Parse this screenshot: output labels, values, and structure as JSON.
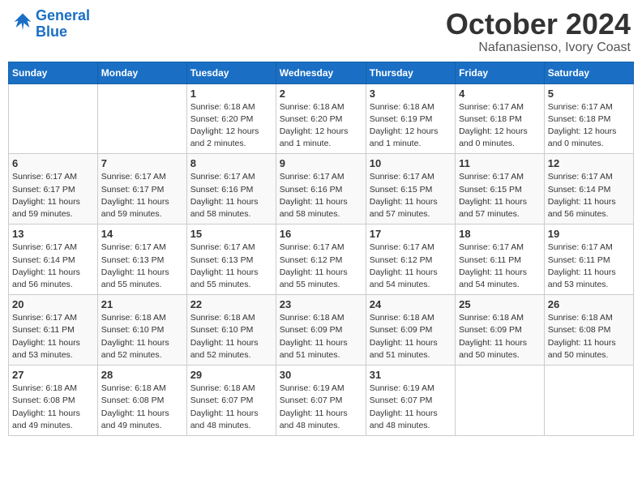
{
  "header": {
    "logo_line1": "General",
    "logo_line2": "Blue",
    "month": "October 2024",
    "location": "Nafanasienso, Ivory Coast"
  },
  "weekdays": [
    "Sunday",
    "Monday",
    "Tuesday",
    "Wednesday",
    "Thursday",
    "Friday",
    "Saturday"
  ],
  "weeks": [
    [
      {
        "day": "",
        "detail": ""
      },
      {
        "day": "",
        "detail": ""
      },
      {
        "day": "1",
        "detail": "Sunrise: 6:18 AM\nSunset: 6:20 PM\nDaylight: 12 hours\nand 2 minutes."
      },
      {
        "day": "2",
        "detail": "Sunrise: 6:18 AM\nSunset: 6:20 PM\nDaylight: 12 hours\nand 1 minute."
      },
      {
        "day": "3",
        "detail": "Sunrise: 6:18 AM\nSunset: 6:19 PM\nDaylight: 12 hours\nand 1 minute."
      },
      {
        "day": "4",
        "detail": "Sunrise: 6:17 AM\nSunset: 6:18 PM\nDaylight: 12 hours\nand 0 minutes."
      },
      {
        "day": "5",
        "detail": "Sunrise: 6:17 AM\nSunset: 6:18 PM\nDaylight: 12 hours\nand 0 minutes."
      }
    ],
    [
      {
        "day": "6",
        "detail": "Sunrise: 6:17 AM\nSunset: 6:17 PM\nDaylight: 11 hours\nand 59 minutes."
      },
      {
        "day": "7",
        "detail": "Sunrise: 6:17 AM\nSunset: 6:17 PM\nDaylight: 11 hours\nand 59 minutes."
      },
      {
        "day": "8",
        "detail": "Sunrise: 6:17 AM\nSunset: 6:16 PM\nDaylight: 11 hours\nand 58 minutes."
      },
      {
        "day": "9",
        "detail": "Sunrise: 6:17 AM\nSunset: 6:16 PM\nDaylight: 11 hours\nand 58 minutes."
      },
      {
        "day": "10",
        "detail": "Sunrise: 6:17 AM\nSunset: 6:15 PM\nDaylight: 11 hours\nand 57 minutes."
      },
      {
        "day": "11",
        "detail": "Sunrise: 6:17 AM\nSunset: 6:15 PM\nDaylight: 11 hours\nand 57 minutes."
      },
      {
        "day": "12",
        "detail": "Sunrise: 6:17 AM\nSunset: 6:14 PM\nDaylight: 11 hours\nand 56 minutes."
      }
    ],
    [
      {
        "day": "13",
        "detail": "Sunrise: 6:17 AM\nSunset: 6:14 PM\nDaylight: 11 hours\nand 56 minutes."
      },
      {
        "day": "14",
        "detail": "Sunrise: 6:17 AM\nSunset: 6:13 PM\nDaylight: 11 hours\nand 55 minutes."
      },
      {
        "day": "15",
        "detail": "Sunrise: 6:17 AM\nSunset: 6:13 PM\nDaylight: 11 hours\nand 55 minutes."
      },
      {
        "day": "16",
        "detail": "Sunrise: 6:17 AM\nSunset: 6:12 PM\nDaylight: 11 hours\nand 55 minutes."
      },
      {
        "day": "17",
        "detail": "Sunrise: 6:17 AM\nSunset: 6:12 PM\nDaylight: 11 hours\nand 54 minutes."
      },
      {
        "day": "18",
        "detail": "Sunrise: 6:17 AM\nSunset: 6:11 PM\nDaylight: 11 hours\nand 54 minutes."
      },
      {
        "day": "19",
        "detail": "Sunrise: 6:17 AM\nSunset: 6:11 PM\nDaylight: 11 hours\nand 53 minutes."
      }
    ],
    [
      {
        "day": "20",
        "detail": "Sunrise: 6:17 AM\nSunset: 6:11 PM\nDaylight: 11 hours\nand 53 minutes."
      },
      {
        "day": "21",
        "detail": "Sunrise: 6:18 AM\nSunset: 6:10 PM\nDaylight: 11 hours\nand 52 minutes."
      },
      {
        "day": "22",
        "detail": "Sunrise: 6:18 AM\nSunset: 6:10 PM\nDaylight: 11 hours\nand 52 minutes."
      },
      {
        "day": "23",
        "detail": "Sunrise: 6:18 AM\nSunset: 6:09 PM\nDaylight: 11 hours\nand 51 minutes."
      },
      {
        "day": "24",
        "detail": "Sunrise: 6:18 AM\nSunset: 6:09 PM\nDaylight: 11 hours\nand 51 minutes."
      },
      {
        "day": "25",
        "detail": "Sunrise: 6:18 AM\nSunset: 6:09 PM\nDaylight: 11 hours\nand 50 minutes."
      },
      {
        "day": "26",
        "detail": "Sunrise: 6:18 AM\nSunset: 6:08 PM\nDaylight: 11 hours\nand 50 minutes."
      }
    ],
    [
      {
        "day": "27",
        "detail": "Sunrise: 6:18 AM\nSunset: 6:08 PM\nDaylight: 11 hours\nand 49 minutes."
      },
      {
        "day": "28",
        "detail": "Sunrise: 6:18 AM\nSunset: 6:08 PM\nDaylight: 11 hours\nand 49 minutes."
      },
      {
        "day": "29",
        "detail": "Sunrise: 6:18 AM\nSunset: 6:07 PM\nDaylight: 11 hours\nand 48 minutes."
      },
      {
        "day": "30",
        "detail": "Sunrise: 6:19 AM\nSunset: 6:07 PM\nDaylight: 11 hours\nand 48 minutes."
      },
      {
        "day": "31",
        "detail": "Sunrise: 6:19 AM\nSunset: 6:07 PM\nDaylight: 11 hours\nand 48 minutes."
      },
      {
        "day": "",
        "detail": ""
      },
      {
        "day": "",
        "detail": ""
      }
    ]
  ]
}
